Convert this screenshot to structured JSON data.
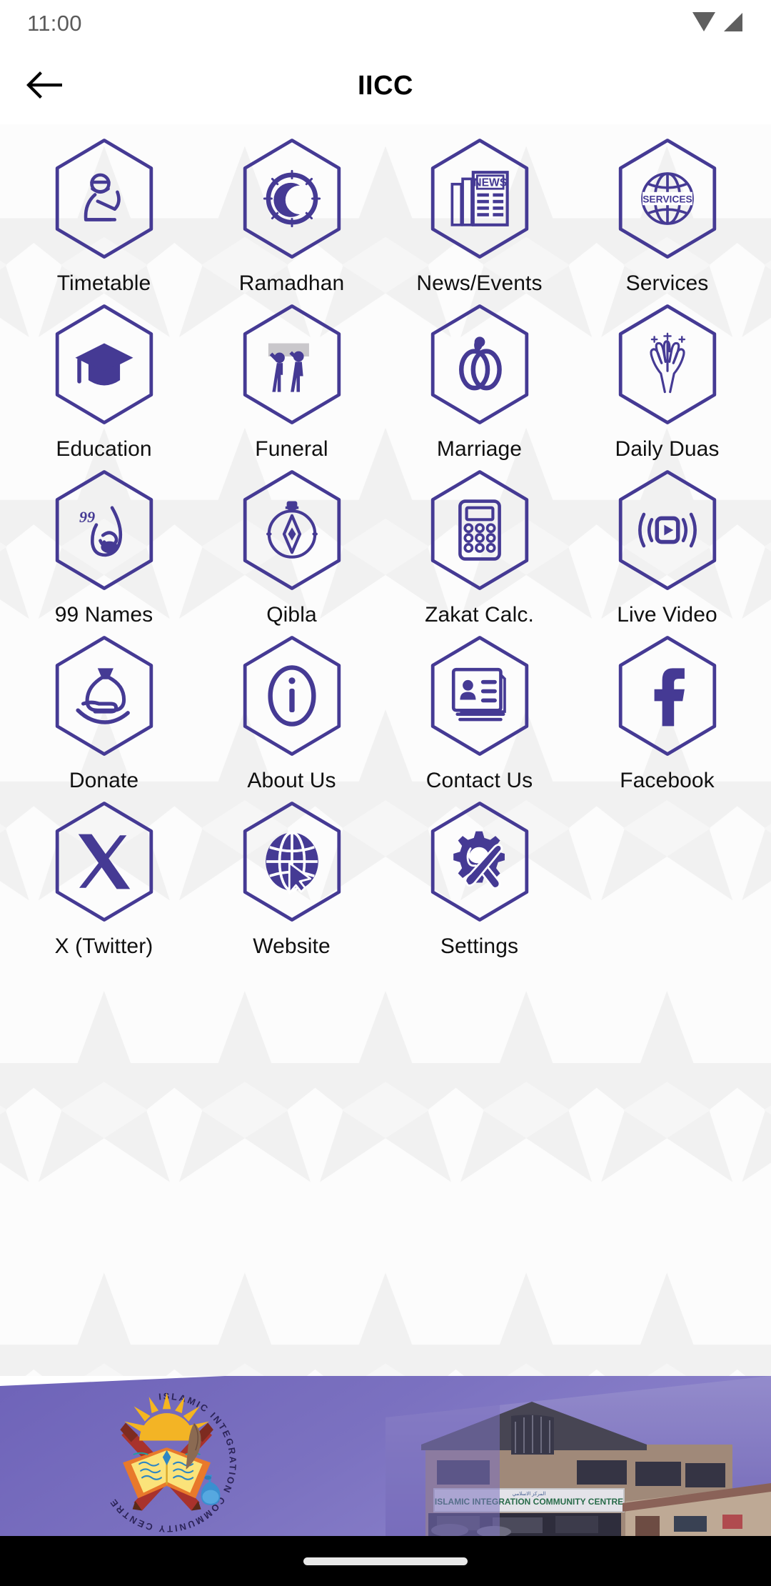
{
  "statusbar": {
    "time": "11:00",
    "icons": [
      "wifi-icon",
      "cellular-signal-icon"
    ]
  },
  "appbar": {
    "title": "IICC",
    "back_icon": "back-arrow-icon"
  },
  "theme": {
    "accent": "#453a94",
    "banner_purple": "#6a5eb4",
    "background": "#fbfbfb",
    "label_color": "#101010"
  },
  "grid": {
    "columns": 4,
    "items": [
      {
        "label": "Timetable",
        "icon": "praying-person-icon"
      },
      {
        "label": "Ramadhan",
        "icon": "moon-clock-icon"
      },
      {
        "label": "News/Events",
        "icon": "newspaper-icon",
        "icon_text": "NEWS"
      },
      {
        "label": "Services",
        "icon": "globe-services-icon",
        "icon_text": "SERVICES"
      },
      {
        "label": "Education",
        "icon": "graduation-cap-icon"
      },
      {
        "label": "Funeral",
        "icon": "pallbearers-casket-icon"
      },
      {
        "label": "Marriage",
        "icon": "wedding-rings-icon"
      },
      {
        "label": "Daily Duas",
        "icon": "praying-hands-icon"
      },
      {
        "label": "99 Names",
        "icon": "allah-calligraphy-icon",
        "icon_text": "99"
      },
      {
        "label": "Qibla",
        "icon": "compass-icon"
      },
      {
        "label": "Zakat Calc.",
        "icon": "calculator-icon"
      },
      {
        "label": "Live Video",
        "icon": "live-broadcast-icon"
      },
      {
        "label": "Donate",
        "icon": "donation-money-bag-icon"
      },
      {
        "label": "About Us",
        "icon": "info-circle-icon"
      },
      {
        "label": "Contact Us",
        "icon": "contact-card-icon"
      },
      {
        "label": "Facebook",
        "icon": "facebook-f-icon"
      },
      {
        "label": "X (Twitter)",
        "icon": "x-twitter-icon"
      },
      {
        "label": "Website",
        "icon": "globe-cursor-icon"
      },
      {
        "label": "Settings",
        "icon": "gear-tools-icon"
      }
    ]
  },
  "banner": {
    "logo_name": "iicc-logo",
    "logo_ring_text": "ISLAMIC INTEGRATION COMMUNITY CENTRE",
    "photo_name": "community-centre-building-photo",
    "photo_sign_text": "ISLAMIC INTEGRATION COMMUNITY CENTRE"
  },
  "navbar": {
    "pill": "home-gesture-pill"
  }
}
